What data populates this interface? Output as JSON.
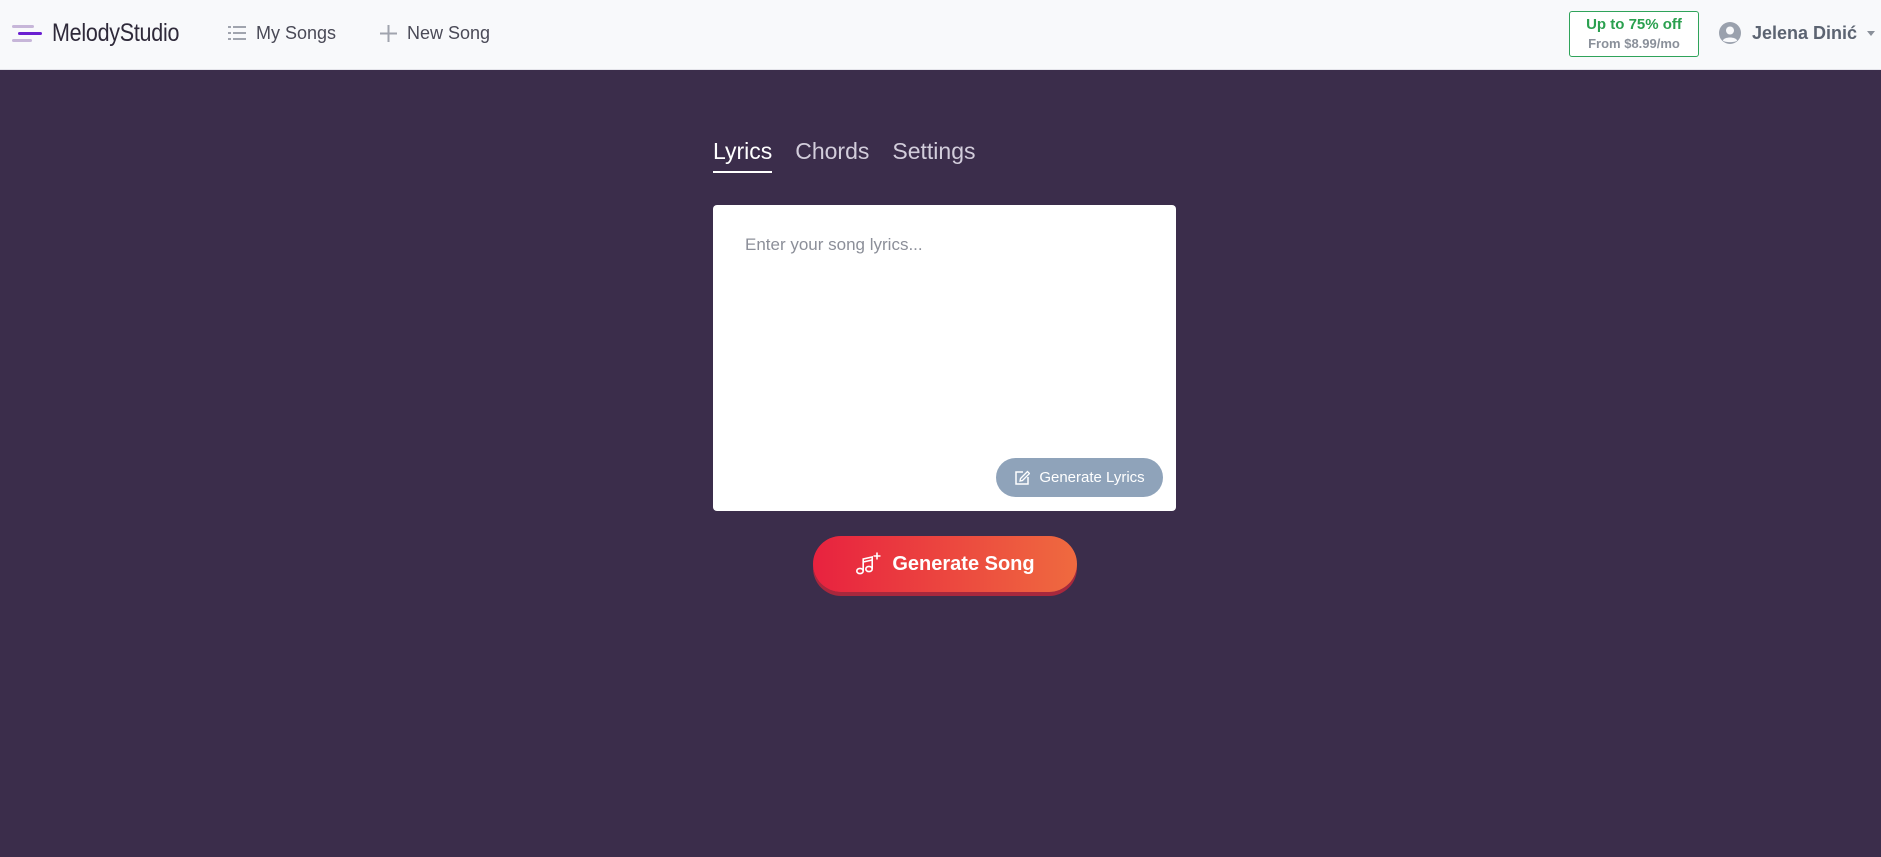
{
  "header": {
    "logo_text": "MelodyStudio",
    "nav": {
      "my_songs": "My Songs",
      "new_song": "New Song"
    },
    "promo": {
      "title": "Up to 75% off",
      "subtitle": "From $8.99/mo"
    },
    "user": {
      "name": "Jelena Dinić"
    }
  },
  "tabs": [
    {
      "label": "Lyrics",
      "active": true
    },
    {
      "label": "Chords",
      "active": false
    },
    {
      "label": "Settings",
      "active": false
    }
  ],
  "lyrics": {
    "placeholder": "Enter your song lyrics...",
    "value": "",
    "generate_button": "Generate Lyrics"
  },
  "generate_song_button": "Generate Song",
  "colors": {
    "page_background": "#3b2d4b",
    "header_background": "#f8f9fb",
    "accent_purple": "#6a1fd1",
    "promo_green": "#2aa04f",
    "generate_lyrics_button": "#8fa3ba",
    "generate_song_gradient_start": "#e8223f",
    "generate_song_gradient_end": "#ef6a3f"
  },
  "icons": {
    "logo": "logo-bars-icon",
    "my_songs": "list-icon",
    "new_song": "plus-icon",
    "user": "user-avatar-icon",
    "user_menu": "caret-down-icon",
    "generate_lyrics": "edit-note-icon",
    "generate_song": "music-note-plus-icon"
  }
}
